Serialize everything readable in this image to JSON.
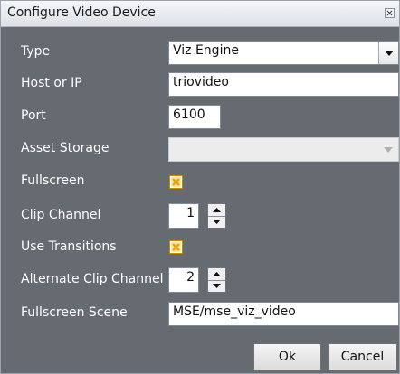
{
  "window": {
    "title": "Configure Video Device",
    "close_icon": "close-icon"
  },
  "form": {
    "type": {
      "label": "Type",
      "value": "Viz Engine"
    },
    "host": {
      "label": "Host or IP",
      "value": "triovideo"
    },
    "port": {
      "label": "Port",
      "value": "6100"
    },
    "asset_storage": {
      "label": "Asset Storage",
      "value": ""
    },
    "fullscreen": {
      "label": "Fullscreen",
      "checked": true
    },
    "clip_channel": {
      "label": "Clip Channel",
      "value": "1"
    },
    "use_transitions": {
      "label": "Use Transitions",
      "checked": true
    },
    "alternate_clip_channel": {
      "label": "Alternate Clip Channel",
      "value": "2"
    },
    "fullscreen_scene": {
      "label": "Fullscreen Scene",
      "value": "MSE/mse_viz_video"
    }
  },
  "buttons": {
    "ok": "Ok",
    "cancel": "Cancel"
  },
  "colors": {
    "background": "#666a71",
    "checkbox_mark": "#f0a000"
  }
}
